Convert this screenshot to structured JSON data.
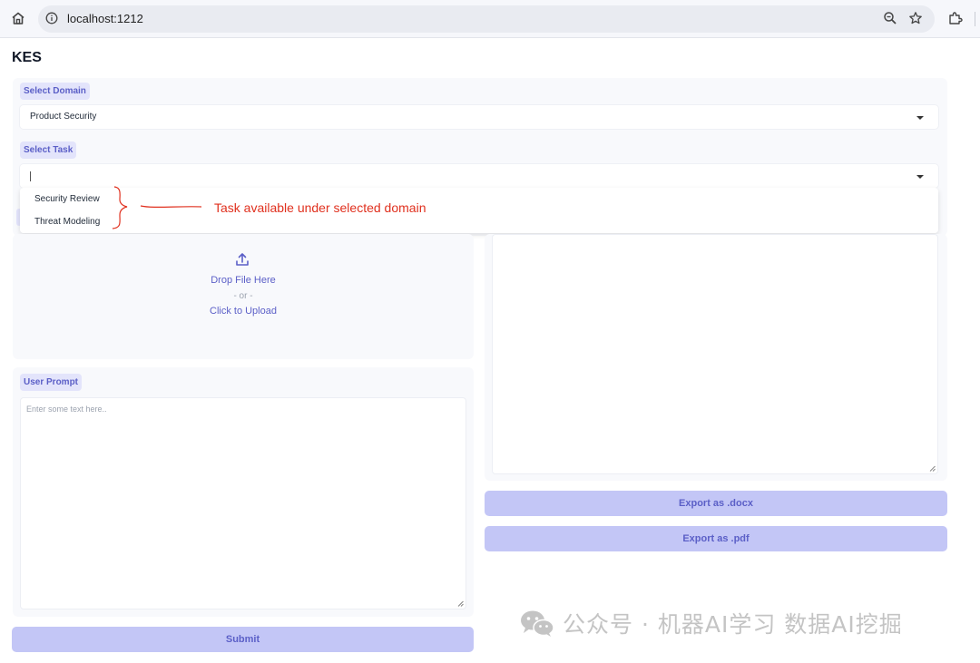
{
  "browser": {
    "url": "localhost:1212"
  },
  "app": {
    "title": "KES"
  },
  "domain_select": {
    "label": "Select Domain",
    "value": "Product Security"
  },
  "task_select": {
    "label": "Select Task",
    "options": [
      "Security Review",
      "Threat Modeling"
    ]
  },
  "annotation": {
    "text": "Task available under selected domain",
    "color": "#e0301e"
  },
  "upload": {
    "drop_label": "Drop File Here",
    "or_label": "- or -",
    "click_label": "Click to Upload"
  },
  "user_prompt": {
    "label": "User Prompt",
    "placeholder": "Enter some text here.."
  },
  "buttons": {
    "export_docx": "Export as .docx",
    "export_pdf": "Export as .pdf",
    "submit": "Submit"
  },
  "watermark": {
    "text": "公众号 · 机器AI学习 数据AI挖掘"
  },
  "colors": {
    "accent": "#5b5fc7",
    "button_bg": "#c3c6f6",
    "chip_bg": "#e3e4fb"
  }
}
